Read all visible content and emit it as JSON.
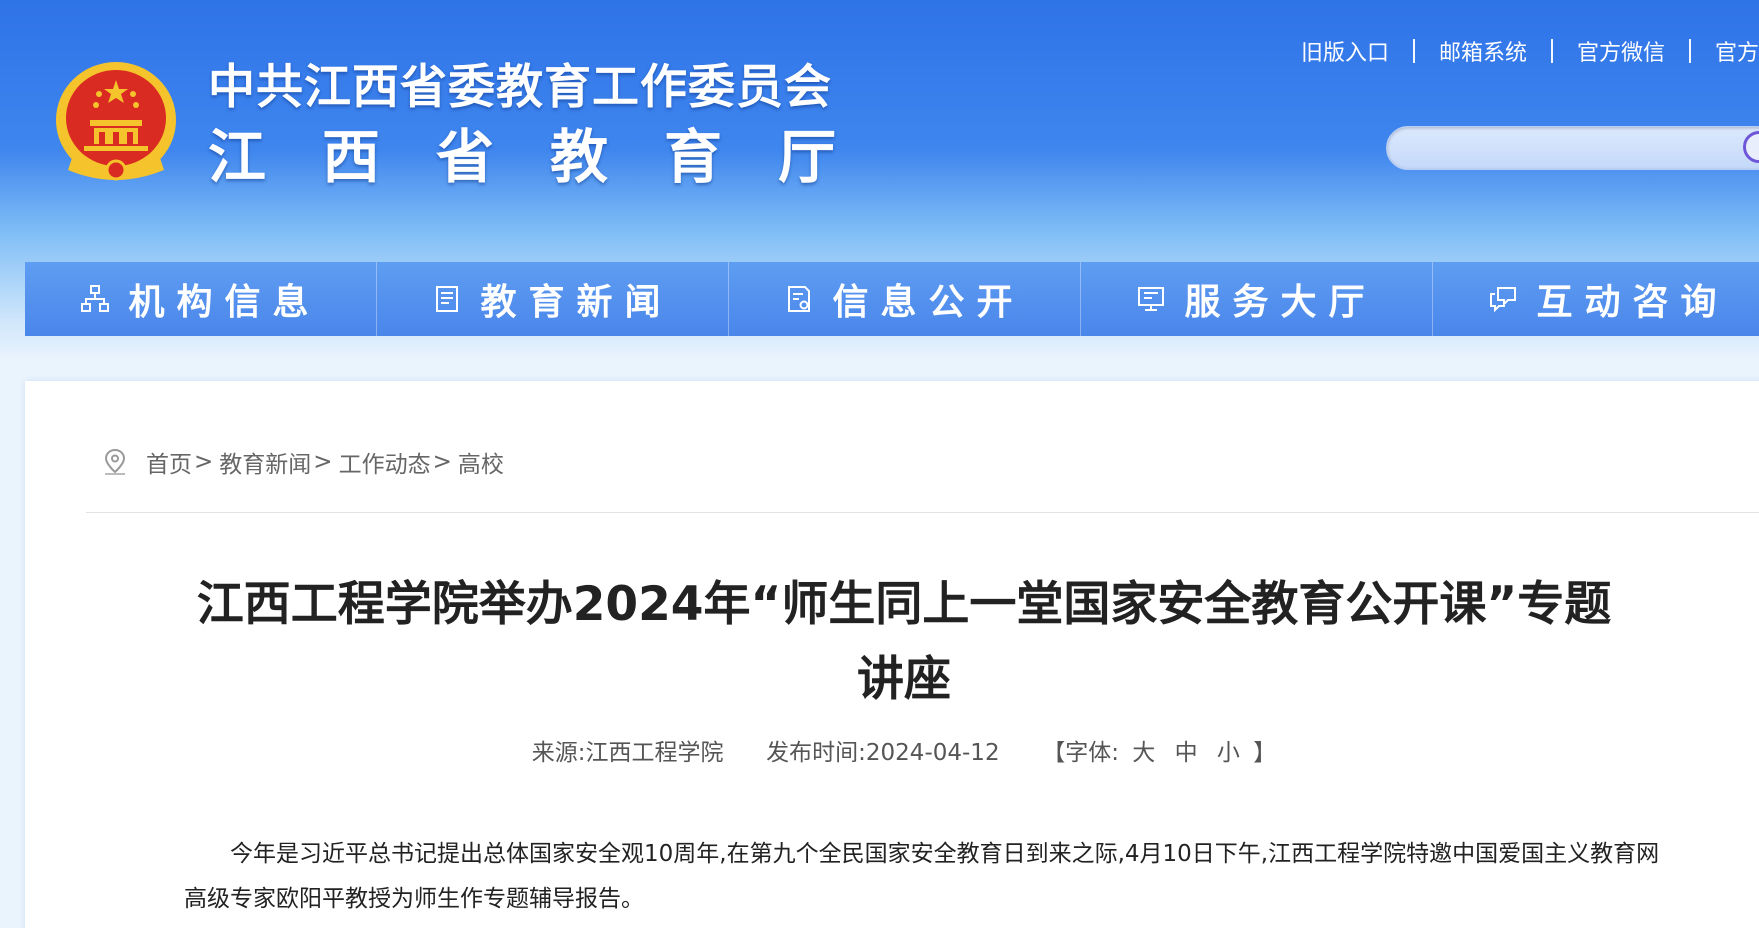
{
  "header": {
    "title_line1": "中共江西省委教育工作委员会",
    "title_line2": "江西省教育厅",
    "top_links": [
      "旧版入口",
      "邮箱系统",
      "官方微信",
      "官方"
    ]
  },
  "search": {
    "placeholder": ""
  },
  "nav": {
    "items": [
      {
        "label": "机构信息",
        "icon": "org-chart-icon"
      },
      {
        "label": "教育新闻",
        "icon": "news-document-icon"
      },
      {
        "label": "信息公开",
        "icon": "public-document-icon"
      },
      {
        "label": "服务大厅",
        "icon": "monitor-icon"
      },
      {
        "label": "互动咨询",
        "icon": "chat-bubbles-icon"
      }
    ]
  },
  "breadcrumb": {
    "items": [
      "首页",
      "教育新闻",
      "工作动态",
      "高校"
    ],
    "separator": ">"
  },
  "article": {
    "title": "江西工程学院举办2024年“师生同上一堂国家安全教育公开课”专题讲座",
    "source_label": "来源:",
    "source": "江西工程学院",
    "date_label": "发布时间:",
    "date": "2024-04-12",
    "font_size_prefix": "【字体:",
    "font_size_options": [
      "大",
      "中",
      "小"
    ],
    "font_size_suffix": "】",
    "body": "今年是习近平总书记提出总体国家安全观10周年,在第九个全民国家安全教育日到来之际,4月10日下午,江西工程学院特邀中国爱国主义教育网高级专家欧阳平教授为师生作专题辅导报告。"
  },
  "colors": {
    "header_blue": "#2f73e8",
    "nav_blue": "#4a86ea",
    "emblem_red": "#d92b21",
    "emblem_gold": "#f5c32c"
  }
}
